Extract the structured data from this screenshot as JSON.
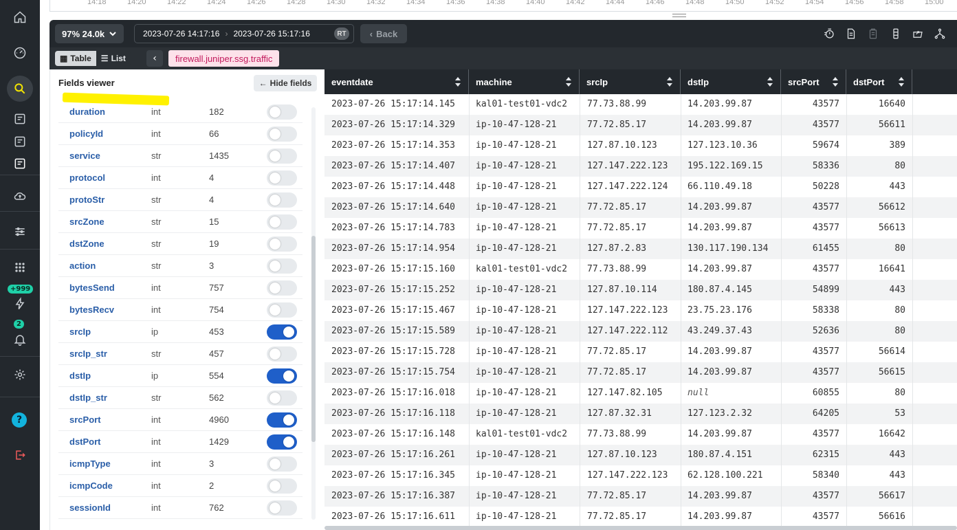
{
  "timeline": {
    "ticks": [
      "14:18",
      "14:20",
      "14:22",
      "14:24",
      "14:26",
      "14:28",
      "14:30",
      "14:32",
      "14:34",
      "14:36",
      "14:38",
      "14:40",
      "14:42",
      "14:44",
      "14:46",
      "14:48",
      "14:50",
      "14:52",
      "14:54",
      "14:56",
      "14:58",
      "15:00"
    ]
  },
  "toolbar": {
    "count_label": "97% 24.0k",
    "range_start": "2023-07-26 14:17:16",
    "range_end": "2023-07-26 15:17:16",
    "rt_label": "RT",
    "back_label": "Back"
  },
  "subbar": {
    "table_label": "Table",
    "list_label": "List",
    "dataset": "firewall.juniper.ssg.traffic"
  },
  "nav": {
    "badge_events": "+999",
    "badge_alerts": "2",
    "help_label": "?"
  },
  "fields": {
    "title": "Fields viewer",
    "hide_label": "Hide fields",
    "items": [
      {
        "name": "duration",
        "type": "int",
        "count": "182",
        "on": false
      },
      {
        "name": "policyId",
        "type": "int",
        "count": "66",
        "on": false
      },
      {
        "name": "service",
        "type": "str",
        "count": "1435",
        "on": false
      },
      {
        "name": "protocol",
        "type": "int",
        "count": "4",
        "on": false
      },
      {
        "name": "protoStr",
        "type": "str",
        "count": "4",
        "on": false
      },
      {
        "name": "srcZone",
        "type": "str",
        "count": "15",
        "on": false
      },
      {
        "name": "dstZone",
        "type": "str",
        "count": "19",
        "on": false
      },
      {
        "name": "action",
        "type": "str",
        "count": "3",
        "on": false
      },
      {
        "name": "bytesSend",
        "type": "int",
        "count": "757",
        "on": false
      },
      {
        "name": "bytesRecv",
        "type": "int",
        "count": "754",
        "on": false
      },
      {
        "name": "srcIp",
        "type": "ip",
        "count": "453",
        "on": true
      },
      {
        "name": "srcIp_str",
        "type": "str",
        "count": "457",
        "on": false
      },
      {
        "name": "dstIp",
        "type": "ip",
        "count": "554",
        "on": true
      },
      {
        "name": "dstIp_str",
        "type": "str",
        "count": "562",
        "on": false
      },
      {
        "name": "srcPort",
        "type": "int",
        "count": "4960",
        "on": true
      },
      {
        "name": "dstPort",
        "type": "int",
        "count": "1429",
        "on": true
      },
      {
        "name": "icmpType",
        "type": "int",
        "count": "3",
        "on": false
      },
      {
        "name": "icmpCode",
        "type": "int",
        "count": "2",
        "on": false
      },
      {
        "name": "sessionId",
        "type": "int",
        "count": "762",
        "on": false
      }
    ]
  },
  "table": {
    "columns": [
      "eventdate",
      "machine",
      "srcIp",
      "dstIp",
      "srcPort",
      "dstPort"
    ],
    "rows": [
      [
        "2023-07-26 15:17:14.145",
        "kal01-test01-vdc2",
        "77.73.88.99",
        "14.203.99.87",
        "43577",
        "16640"
      ],
      [
        "2023-07-26 15:17:14.329",
        "ip-10-47-128-21",
        "77.72.85.17",
        "14.203.99.87",
        "43577",
        "56611"
      ],
      [
        "2023-07-26 15:17:14.353",
        "ip-10-47-128-21",
        "127.87.10.123",
        "127.123.10.36",
        "59674",
        "389"
      ],
      [
        "2023-07-26 15:17:14.407",
        "ip-10-47-128-21",
        "127.147.222.123",
        "195.122.169.15",
        "58336",
        "80"
      ],
      [
        "2023-07-26 15:17:14.448",
        "ip-10-47-128-21",
        "127.147.222.124",
        "66.110.49.18",
        "50228",
        "443"
      ],
      [
        "2023-07-26 15:17:14.640",
        "ip-10-47-128-21",
        "77.72.85.17",
        "14.203.99.87",
        "43577",
        "56612"
      ],
      [
        "2023-07-26 15:17:14.783",
        "ip-10-47-128-21",
        "77.72.85.17",
        "14.203.99.87",
        "43577",
        "56613"
      ],
      [
        "2023-07-26 15:17:14.954",
        "ip-10-47-128-21",
        "127.87.2.83",
        "130.117.190.134",
        "61455",
        "80"
      ],
      [
        "2023-07-26 15:17:15.160",
        "kal01-test01-vdc2",
        "77.73.88.99",
        "14.203.99.87",
        "43577",
        "16641"
      ],
      [
        "2023-07-26 15:17:15.252",
        "ip-10-47-128-21",
        "127.87.10.114",
        "180.87.4.145",
        "54899",
        "443"
      ],
      [
        "2023-07-26 15:17:15.467",
        "ip-10-47-128-21",
        "127.147.222.123",
        "23.75.23.176",
        "58338",
        "80"
      ],
      [
        "2023-07-26 15:17:15.589",
        "ip-10-47-128-21",
        "127.147.222.112",
        "43.249.37.43",
        "52636",
        "80"
      ],
      [
        "2023-07-26 15:17:15.728",
        "ip-10-47-128-21",
        "77.72.85.17",
        "14.203.99.87",
        "43577",
        "56614"
      ],
      [
        "2023-07-26 15:17:15.754",
        "ip-10-47-128-21",
        "77.72.85.17",
        "14.203.99.87",
        "43577",
        "56615"
      ],
      [
        "2023-07-26 15:17:16.018",
        "ip-10-47-128-21",
        "127.147.82.105",
        "null",
        "60855",
        "80"
      ],
      [
        "2023-07-26 15:17:16.118",
        "ip-10-47-128-21",
        "127.87.32.31",
        "127.123.2.32",
        "64205",
        "53"
      ],
      [
        "2023-07-26 15:17:16.148",
        "kal01-test01-vdc2",
        "77.73.88.99",
        "14.203.99.87",
        "43577",
        "16642"
      ],
      [
        "2023-07-26 15:17:16.261",
        "ip-10-47-128-21",
        "127.87.10.123",
        "180.87.4.151",
        "62315",
        "443"
      ],
      [
        "2023-07-26 15:17:16.345",
        "ip-10-47-128-21",
        "127.147.222.123",
        "62.128.100.221",
        "58340",
        "443"
      ],
      [
        "2023-07-26 15:17:16.387",
        "ip-10-47-128-21",
        "77.72.85.17",
        "14.203.99.87",
        "43577",
        "56617"
      ],
      [
        "2023-07-26 15:17:16.611",
        "ip-10-47-128-21",
        "77.72.85.17",
        "14.203.99.87",
        "43577",
        "56616"
      ]
    ]
  },
  "colors": {
    "accent": "#1f5fc9",
    "nav_bg": "#23282d",
    "highlight": "#fff100",
    "dataset_text": "#c2185b"
  }
}
